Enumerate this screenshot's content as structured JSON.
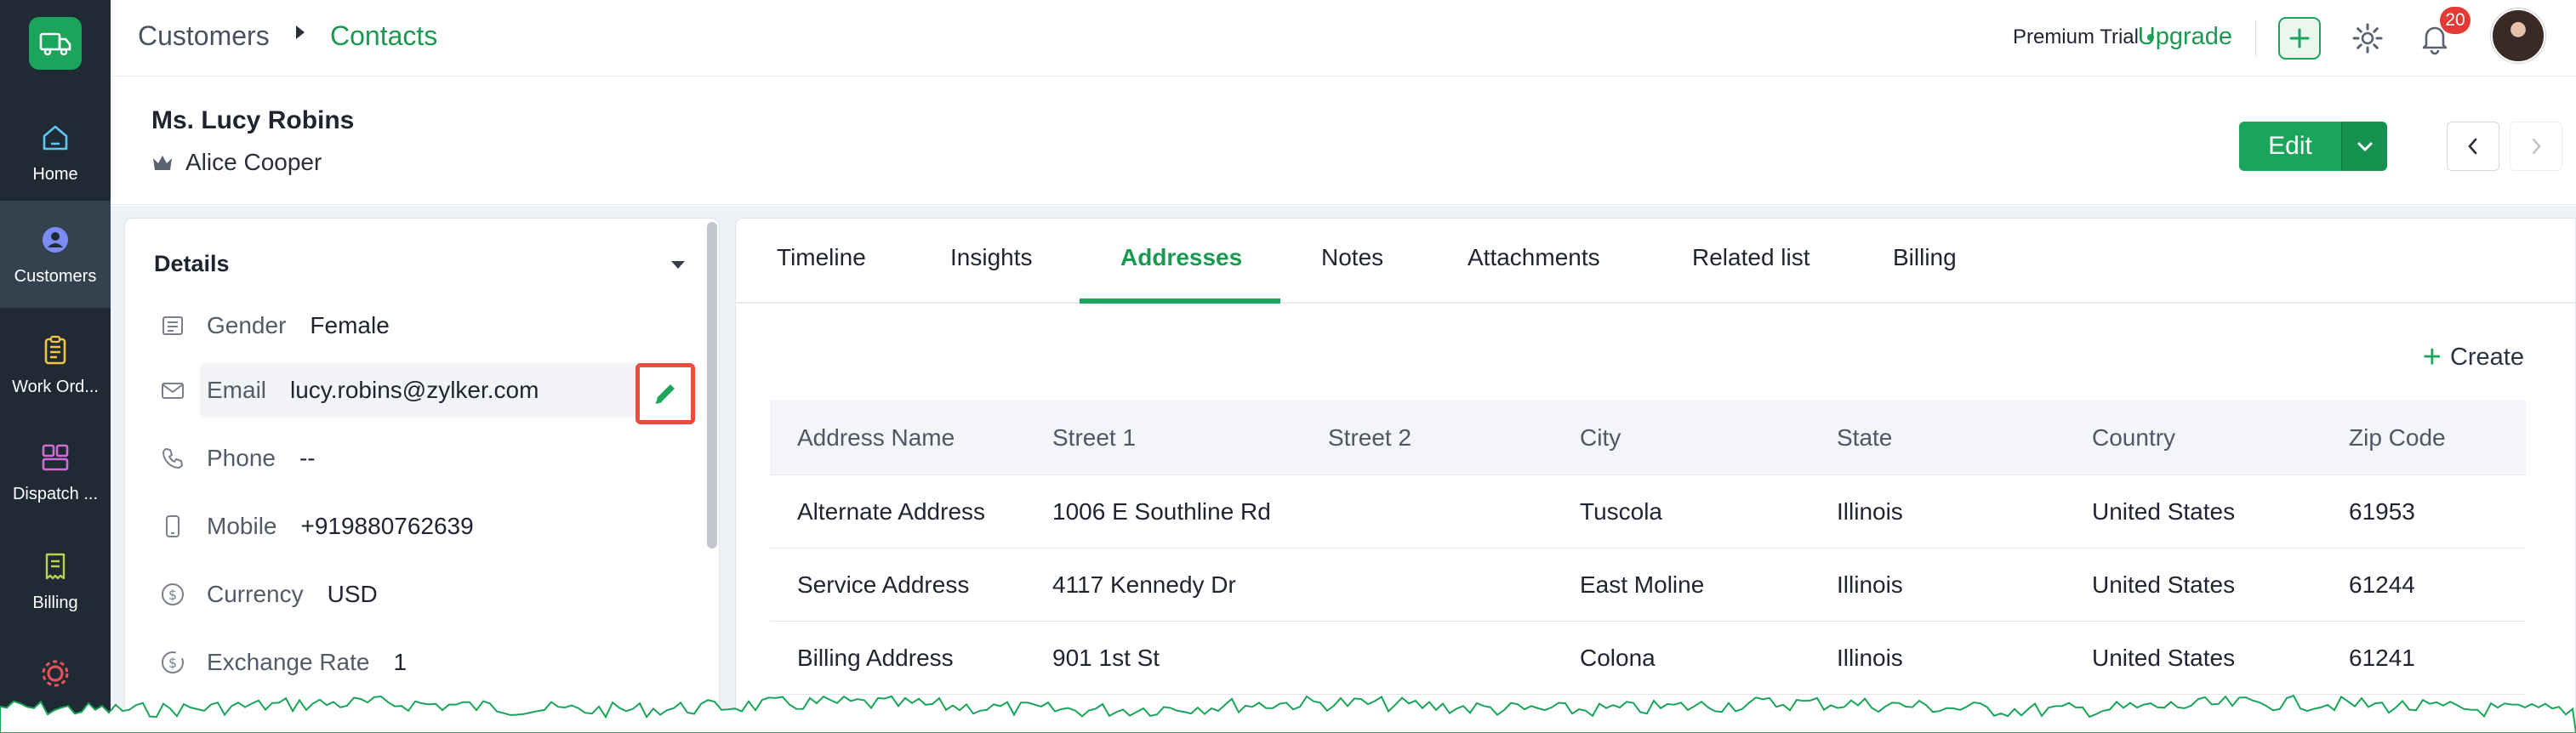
{
  "sidebar": {
    "items": [
      {
        "label": "Home",
        "icon": "home-icon",
        "active": false
      },
      {
        "label": "Customers",
        "icon": "user-icon",
        "active": true
      },
      {
        "label": "Work Ord...",
        "icon": "clipboard-icon",
        "active": false
      },
      {
        "label": "Dispatch ...",
        "icon": "dispatch-icon",
        "active": false
      },
      {
        "label": "Billing",
        "icon": "billing-icon",
        "active": false
      }
    ]
  },
  "breadcrumb": {
    "parent": "Customers",
    "current": "Contacts"
  },
  "topbar": {
    "trial_text": "Premium Trial",
    "upgrade_label": "Upgrade",
    "notification_count": "20"
  },
  "record": {
    "name": "Ms. Lucy Robins",
    "owner": "Alice Cooper",
    "edit_label": "Edit"
  },
  "details": {
    "title": "Details",
    "fields": [
      {
        "label": "Gender",
        "value": "Female",
        "icon": "gender-icon"
      },
      {
        "label": "Email",
        "value": "lucy.robins@zylker.com",
        "icon": "mail-icon"
      },
      {
        "label": "Phone",
        "value": "--",
        "icon": "phone-icon"
      },
      {
        "label": "Mobile",
        "value": "+919880762639",
        "icon": "mobile-icon"
      },
      {
        "label": "Currency",
        "value": "USD",
        "icon": "currency-icon"
      },
      {
        "label": "Exchange Rate",
        "value": "1",
        "icon": "exchange-rate-icon"
      }
    ]
  },
  "tabs": [
    {
      "label": "Timeline"
    },
    {
      "label": "Insights"
    },
    {
      "label": "Addresses"
    },
    {
      "label": "Notes"
    },
    {
      "label": "Attachments"
    },
    {
      "label": "Related list"
    },
    {
      "label": "Billing"
    }
  ],
  "active_tab": "Addresses",
  "addresses": {
    "create_label": "Create",
    "columns": [
      "Address Name",
      "Street 1",
      "Street 2",
      "City",
      "State",
      "Country",
      "Zip Code"
    ],
    "rows": [
      [
        "Alternate Address",
        "1006 E Southline Rd",
        "",
        "Tuscola",
        "Illinois",
        "United States",
        "61953"
      ],
      [
        "Service Address",
        "4117 Kennedy Dr",
        "",
        "East Moline",
        "Illinois",
        "United States",
        "61244"
      ],
      [
        "Billing Address",
        "901 1st St",
        "",
        "Colona",
        "Illinois",
        "United States",
        "61241"
      ]
    ]
  },
  "colors": {
    "accent": "#1aa55a",
    "sidebar_bg": "#1f2a35",
    "highlight_border": "#ef4b3c",
    "badge": "#e53935"
  }
}
